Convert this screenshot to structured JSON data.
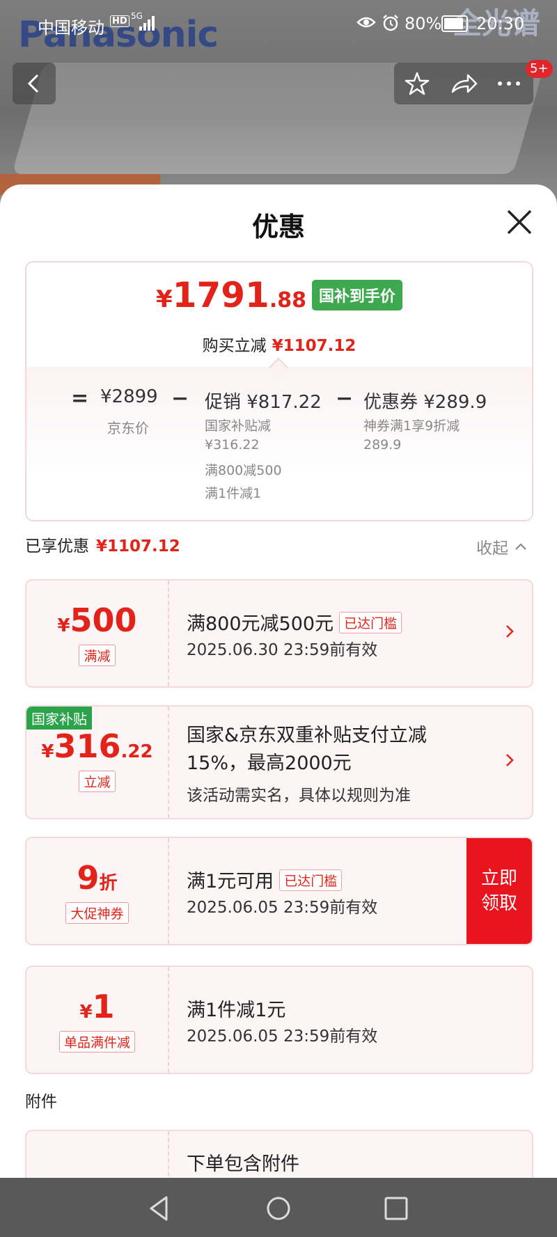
{
  "background": {
    "brand": "Panasonic",
    "promo_text": "全光谱"
  },
  "status_bar": {
    "carrier": "中国移动",
    "hd": "HD",
    "network": "5G",
    "battery": "80%",
    "time": "20:30"
  },
  "top_nav": {
    "badge": "5+"
  },
  "sheet": {
    "title": "优惠",
    "summary": {
      "price_currency": "¥",
      "price_integer": "1791",
      "price_decimal": ".88",
      "price_tag": "国补到手价",
      "buy_reduce_label": "购买立减",
      "buy_reduce_value": "¥1107.12",
      "eq": "=",
      "jd_price": "¥2899",
      "jd_price_label": "京东价",
      "minus1": "−",
      "promo_label": "促销 ¥817.22",
      "promo_lines": [
        "国家补贴减",
        "¥316.22",
        "满800减500",
        "满1件减1"
      ],
      "minus2": "−",
      "coupon_label": "优惠券 ¥289.9",
      "coupon_lines": [
        "神券满1享9折减",
        "289.9"
      ]
    },
    "enjoyed_label": "已享优惠",
    "enjoyed_value": "¥1107.12",
    "collapse": "收起",
    "cards": [
      {
        "currency": "¥",
        "amount": "500",
        "decimal": "",
        "kind": "满减",
        "title": "满800元减500元",
        "threshold_tag": "已达门槛",
        "date": "2025.06.30 23:59前有效"
      },
      {
        "gov_tag": "国家补贴",
        "currency": "¥",
        "amount": "316",
        "decimal": ".22",
        "kind": "立减",
        "title_line1": "国家&京东双重补贴支付立减",
        "title_line2": "15%，最高2000元",
        "note": "该活动需实名，具体以规则为准"
      },
      {
        "amount": "9",
        "unit": "折",
        "kind": "大促神券",
        "title": "满1元可用",
        "threshold_tag": "已达门槛",
        "date": "2025.06.05 23:59前有效",
        "claim_line1": "立即",
        "claim_line2": "领取"
      },
      {
        "currency": "¥",
        "amount": "1",
        "kind": "单品满件减",
        "title": "满1件减1元",
        "date": "2025.06.05 23:59前有效"
      }
    ],
    "attachments_label": "附件",
    "attachment_card": {
      "title": "下单包含附件"
    }
  },
  "colors": {
    "accent_red": "#e2231a",
    "gov_green": "#2aa34a",
    "claim_red": "#e8151f"
  }
}
